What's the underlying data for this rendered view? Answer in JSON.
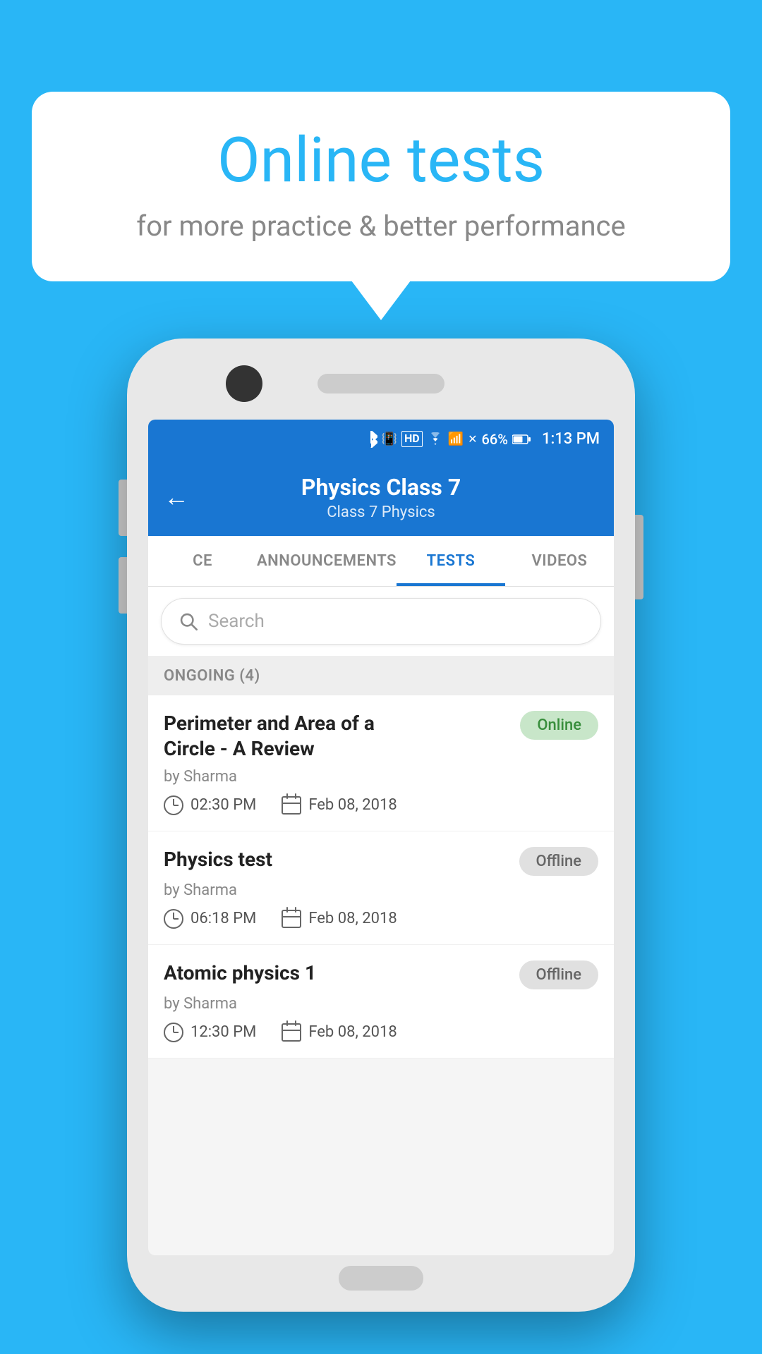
{
  "page": {
    "background_color": "#29b6f6"
  },
  "speech_bubble": {
    "title": "Online tests",
    "subtitle": "for more practice & better performance"
  },
  "status_bar": {
    "battery": "66%",
    "time": "1:13 PM",
    "icons": "bluetooth vibrate hd wifi signal"
  },
  "app_bar": {
    "title": "Physics Class 7",
    "subtitle": "Class 7   Physics",
    "back_label": "←"
  },
  "tabs": [
    {
      "label": "CE",
      "active": false
    },
    {
      "label": "ANNOUNCEMENTS",
      "active": false
    },
    {
      "label": "TESTS",
      "active": true
    },
    {
      "label": "VIDEOS",
      "active": false
    }
  ],
  "search": {
    "placeholder": "Search"
  },
  "section": {
    "header": "ONGOING (4)"
  },
  "tests": [
    {
      "title": "Perimeter and Area of a Circle - A Review",
      "author": "by Sharma",
      "time": "02:30 PM",
      "date": "Feb 08, 2018",
      "status": "Online",
      "status_type": "online"
    },
    {
      "title": "Physics test",
      "author": "by Sharma",
      "time": "06:18 PM",
      "date": "Feb 08, 2018",
      "status": "Offline",
      "status_type": "offline"
    },
    {
      "title": "Atomic physics 1",
      "author": "by Sharma",
      "time": "12:30 PM",
      "date": "Feb 08, 2018",
      "status": "Offline",
      "status_type": "offline"
    }
  ]
}
